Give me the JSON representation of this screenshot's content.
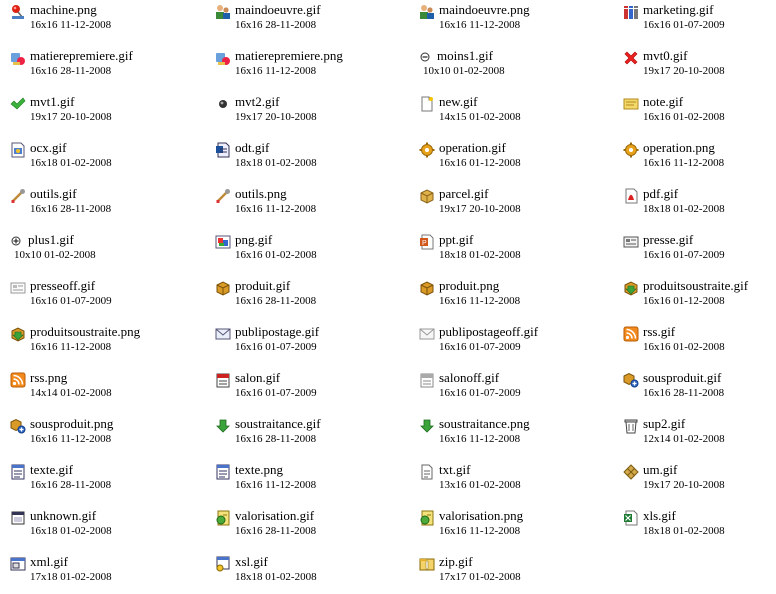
{
  "files": [
    {
      "name": "machine.png",
      "dims": "16x16",
      "date": "11-12-2008",
      "icon": "pushpin-icon"
    },
    {
      "name": "maindoeuvre.gif",
      "dims": "16x16",
      "date": "28-11-2008",
      "icon": "workers-icon"
    },
    {
      "name": "maindoeuvre.png",
      "dims": "16x16",
      "date": "11-12-2008",
      "icon": "workers-icon"
    },
    {
      "name": "marketing.gif",
      "dims": "16x16",
      "date": "01-07-2009",
      "icon": "marketing-icon"
    },
    {
      "name": "matierepremiere.gif",
      "dims": "16x16",
      "date": "28-11-2008",
      "icon": "raw-material-icon"
    },
    {
      "name": "matierepremiere.png",
      "dims": "16x16",
      "date": "11-12-2008",
      "icon": "raw-material-icon"
    },
    {
      "name": "moins1.gif",
      "dims": "10x10",
      "date": "01-02-2008",
      "icon": "minus-icon"
    },
    {
      "name": "mvt0.gif",
      "dims": "19x17",
      "date": "20-10-2008",
      "icon": "red-cross-icon"
    },
    {
      "name": "mvt1.gif",
      "dims": "19x17",
      "date": "20-10-2008",
      "icon": "green-check-icon"
    },
    {
      "name": "mvt2.gif",
      "dims": "19x17",
      "date": "20-10-2008",
      "icon": "dot-icon"
    },
    {
      "name": "new.gif",
      "dims": "14x15",
      "date": "01-02-2008",
      "icon": "new-document-icon"
    },
    {
      "name": "note.gif",
      "dims": "16x16",
      "date": "01-02-2008",
      "icon": "note-icon"
    },
    {
      "name": "ocx.gif",
      "dims": "16x18",
      "date": "01-02-2008",
      "icon": "ocx-file-icon"
    },
    {
      "name": "odt.gif",
      "dims": "18x18",
      "date": "01-02-2008",
      "icon": "odt-file-icon"
    },
    {
      "name": "operation.gif",
      "dims": "16x16",
      "date": "01-12-2008",
      "icon": "gear-icon"
    },
    {
      "name": "operation.png",
      "dims": "16x16",
      "date": "11-12-2008",
      "icon": "gear-icon"
    },
    {
      "name": "outils.gif",
      "dims": "16x16",
      "date": "28-11-2008",
      "icon": "tools-icon"
    },
    {
      "name": "outils.png",
      "dims": "16x16",
      "date": "11-12-2008",
      "icon": "tools-icon"
    },
    {
      "name": "parcel.gif",
      "dims": "19x17",
      "date": "20-10-2008",
      "icon": "parcel-icon"
    },
    {
      "name": "pdf.gif",
      "dims": "18x18",
      "date": "01-02-2008",
      "icon": "pdf-file-icon"
    },
    {
      "name": "plus1.gif",
      "dims": "10x10",
      "date": "01-02-2008",
      "icon": "plus-icon"
    },
    {
      "name": "png.gif",
      "dims": "16x16",
      "date": "01-02-2008",
      "icon": "image-file-icon"
    },
    {
      "name": "ppt.gif",
      "dims": "18x18",
      "date": "01-02-2008",
      "icon": "ppt-file-icon"
    },
    {
      "name": "presse.gif",
      "dims": "16x16",
      "date": "01-07-2009",
      "icon": "newspaper-icon"
    },
    {
      "name": "presseoff.gif",
      "dims": "16x16",
      "date": "01-07-2009",
      "icon": "newspaper-off-icon"
    },
    {
      "name": "produit.gif",
      "dims": "16x16",
      "date": "28-11-2008",
      "icon": "box-icon"
    },
    {
      "name": "produit.png",
      "dims": "16x16",
      "date": "11-12-2008",
      "icon": "box-icon"
    },
    {
      "name": "produitsoustraite.gif",
      "dims": "16x16",
      "date": "01-12-2008",
      "icon": "box-subcontract-icon"
    },
    {
      "name": "produitsoustraite.png",
      "dims": "16x16",
      "date": "11-12-2008",
      "icon": "box-subcontract-icon"
    },
    {
      "name": "publipostage.gif",
      "dims": "16x16",
      "date": "01-07-2009",
      "icon": "envelope-icon"
    },
    {
      "name": "publipostageoff.gif",
      "dims": "16x16",
      "date": "01-07-2009",
      "icon": "envelope-off-icon"
    },
    {
      "name": "rss.gif",
      "dims": "16x16",
      "date": "01-02-2008",
      "icon": "rss-icon"
    },
    {
      "name": "rss.png",
      "dims": "14x14",
      "date": "01-02-2008",
      "icon": "rss-icon"
    },
    {
      "name": "salon.gif",
      "dims": "16x16",
      "date": "01-07-2009",
      "icon": "calendar-icon"
    },
    {
      "name": "salonoff.gif",
      "dims": "16x16",
      "date": "01-07-2009",
      "icon": "calendar-off-icon"
    },
    {
      "name": "sousproduit.gif",
      "dims": "16x16",
      "date": "28-11-2008",
      "icon": "subproduct-icon"
    },
    {
      "name": "sousproduit.png",
      "dims": "16x16",
      "date": "11-12-2008",
      "icon": "subproduct-icon"
    },
    {
      "name": "soustraitance.gif",
      "dims": "16x16",
      "date": "28-11-2008",
      "icon": "green-down-arrow-icon"
    },
    {
      "name": "soustraitance.png",
      "dims": "16x16",
      "date": "11-12-2008",
      "icon": "green-down-arrow-icon"
    },
    {
      "name": "sup2.gif",
      "dims": "12x14",
      "date": "01-02-2008",
      "icon": "trash-icon"
    },
    {
      "name": "texte.gif",
      "dims": "16x16",
      "date": "28-11-2008",
      "icon": "text-file-icon"
    },
    {
      "name": "texte.png",
      "dims": "16x16",
      "date": "11-12-2008",
      "icon": "text-file-icon"
    },
    {
      "name": "txt.gif",
      "dims": "13x16",
      "date": "01-02-2008",
      "icon": "txt-file-icon"
    },
    {
      "name": "um.gif",
      "dims": "19x17",
      "date": "20-10-2008",
      "icon": "grid-tiles-icon"
    },
    {
      "name": "unknown.gif",
      "dims": "16x18",
      "date": "01-02-2008",
      "icon": "unknown-file-icon"
    },
    {
      "name": "valorisation.gif",
      "dims": "16x16",
      "date": "28-11-2008",
      "icon": "valuation-icon"
    },
    {
      "name": "valorisation.png",
      "dims": "16x16",
      "date": "11-12-2008",
      "icon": "valuation-icon"
    },
    {
      "name": "xls.gif",
      "dims": "18x18",
      "date": "01-02-2008",
      "icon": "xls-file-icon"
    },
    {
      "name": "xml.gif",
      "dims": "17x18",
      "date": "01-02-2008",
      "icon": "xml-file-icon"
    },
    {
      "name": "xsl.gif",
      "dims": "18x18",
      "date": "01-02-2008",
      "icon": "xsl-file-icon"
    },
    {
      "name": "zip.gif",
      "dims": "17x17",
      "date": "01-02-2008",
      "icon": "zip-file-icon"
    }
  ]
}
